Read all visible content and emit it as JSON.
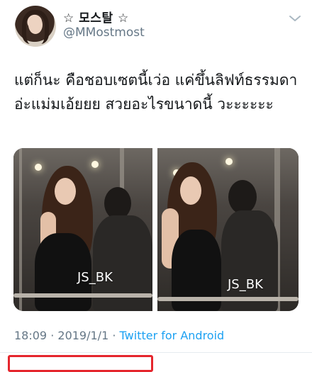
{
  "user": {
    "display_name": "☆ 모스탈 ☆",
    "handle": "@MMostmost"
  },
  "tweet": {
    "text": "แต่ก็นะ คือชอบเซตนี้เว่อ แค่ขึ้นลิฟท์ธรรมดาอ่ะแม่มเอ้ยยย สวยอะไรขนาดนี้ วะะะะะะ"
  },
  "media": {
    "watermarks": [
      "JS_BK",
      "JS_BK"
    ]
  },
  "meta": {
    "time": "18:09",
    "date": "2019/1/1",
    "separator": "·",
    "source": "Twitter for Android"
  },
  "colors": {
    "text": "#14171a",
    "secondary": "#657786",
    "link": "#1da1f2",
    "highlight_box": "#e5262d"
  },
  "icons": {
    "menu": "chevron-down-icon"
  }
}
